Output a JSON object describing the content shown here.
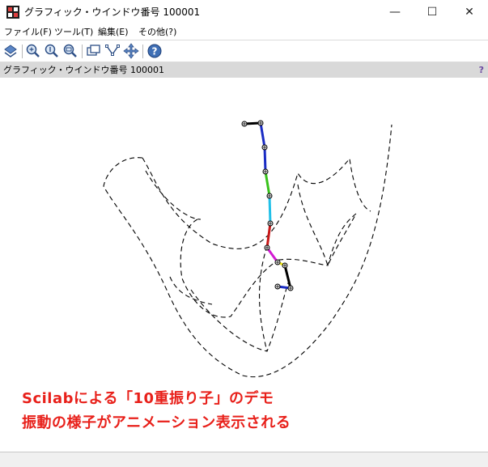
{
  "window": {
    "title": "グラフィック・ウインドウ番号 100001",
    "minimize_glyph": "—",
    "maximize_glyph": "☐",
    "close_glyph": "✕"
  },
  "menubar": {
    "items": [
      {
        "label": "ファイル(F)"
      },
      {
        "label": "ツール(T)"
      },
      {
        "label": "編集(E)"
      },
      {
        "label": "その他(?)"
      }
    ]
  },
  "toolbar": {
    "buttons": [
      {
        "icon": "rotate-icon"
      },
      {
        "icon": "zoom-icon"
      },
      {
        "icon": "zoom-reset-icon"
      },
      {
        "icon": "zoom-out-icon"
      },
      {
        "icon": "datatip-icon"
      },
      {
        "icon": "edit-curve-icon"
      },
      {
        "icon": "pan-icon"
      },
      {
        "icon": "help-icon"
      }
    ]
  },
  "figure": {
    "title": "グラフィック・ウインドウ番号 100001",
    "help_label": "?"
  },
  "captions": {
    "line1": "Scilabによる「10重振り子」のデモ",
    "line2": "振動の様子がアニメーション表示される"
  },
  "colors": {
    "caption": "#e8201a",
    "trace": "#000000",
    "figure_bar": "#d9d9d9",
    "pendulum_segments": [
      "#000000",
      "#1a2cc4",
      "#1a2cc4",
      "#38c21a",
      "#21c0e8",
      "#c81818",
      "#d21ad2",
      "#f0e81a",
      "#000000",
      "#1a2cc4"
    ]
  },
  "statusbar": {
    "text": ""
  }
}
